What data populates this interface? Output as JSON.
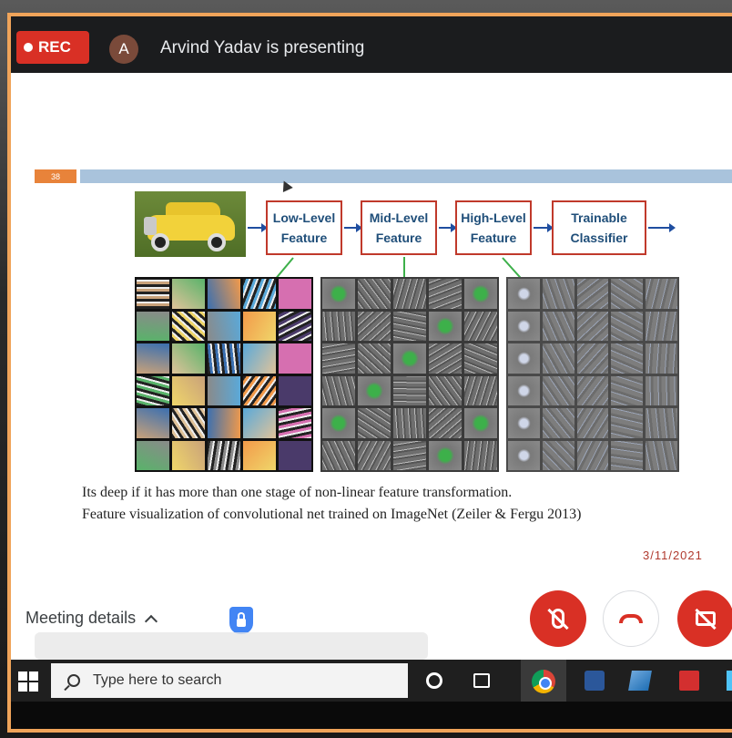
{
  "topbar": {
    "rec_label": "REC",
    "avatar_initial": "A",
    "presenting_text": "Arvind Yadav is presenting"
  },
  "slide": {
    "slide_number": "38",
    "boxes": [
      {
        "line1": "Low-Level",
        "line2": "Feature"
      },
      {
        "line1": "Mid-Level",
        "line2": "Feature"
      },
      {
        "line1": "High-Level",
        "line2": "Feature"
      },
      {
        "line1": "Trainable",
        "line2": "Classifier"
      }
    ],
    "caption_line1": "Its deep if it has more than one stage of non-linear feature transformation.",
    "caption_line2": "Feature visualization of convolutional net trained on ImageNet (Zeiler & Fergu 2013)",
    "date": "3/11/2021",
    "colors": {
      "box_border": "#c0392b",
      "box_text": "#1f4e79",
      "arrow": "#1f4ea0",
      "connector": "#3db04a",
      "rule": "#a9c3dc",
      "number_tab": "#e8833a"
    }
  },
  "meeting_bar": {
    "details_label": "Meeting details",
    "icons": [
      "chevron-up-icon",
      "shield-lock-icon",
      "mic-off-icon",
      "hang-up-icon",
      "camera-off-icon"
    ],
    "accent": "#d93025"
  },
  "taskbar": {
    "search_placeholder": "Type here to search",
    "icons": [
      "windows-start-icon",
      "search-icon",
      "cortana-icon",
      "task-view-icon",
      "chrome-icon",
      "word-icon",
      "app-icon",
      "acrobat-icon",
      "app-icon-partial"
    ]
  },
  "frame_color": "#f0a45a"
}
